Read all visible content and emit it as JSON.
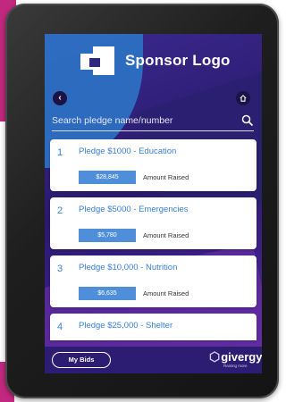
{
  "header": {
    "logo_text": "Sponsor Logo",
    "back_icon": "chevron-left-icon",
    "home_icon": "home-icon"
  },
  "search": {
    "placeholder": "Search pledge name/number",
    "icon": "search-icon"
  },
  "pledges": [
    {
      "number": "1",
      "title": "Pledge $1000 - Education",
      "amount": "$28,845",
      "amount_label": "Amount Raised"
    },
    {
      "number": "2",
      "title": "Pledge $5000 - Emergencies",
      "amount": "$5,780",
      "amount_label": "Amount Raised"
    },
    {
      "number": "3",
      "title": "Pledge $10,000 - Nutrition",
      "amount": "$6,635",
      "amount_label": "Amount Raised"
    },
    {
      "number": "4",
      "title": "Pledge $25,000 - Shelter"
    }
  ],
  "footer": {
    "my_bids_label": "My Bids",
    "brand": "givergy",
    "tagline": "Raising more"
  },
  "colors": {
    "background_pink": "#c2287f",
    "screen_purple": "#3b2a8d",
    "accent_blue": "#3a7fd3",
    "amount_blue": "#4f8fd9"
  }
}
